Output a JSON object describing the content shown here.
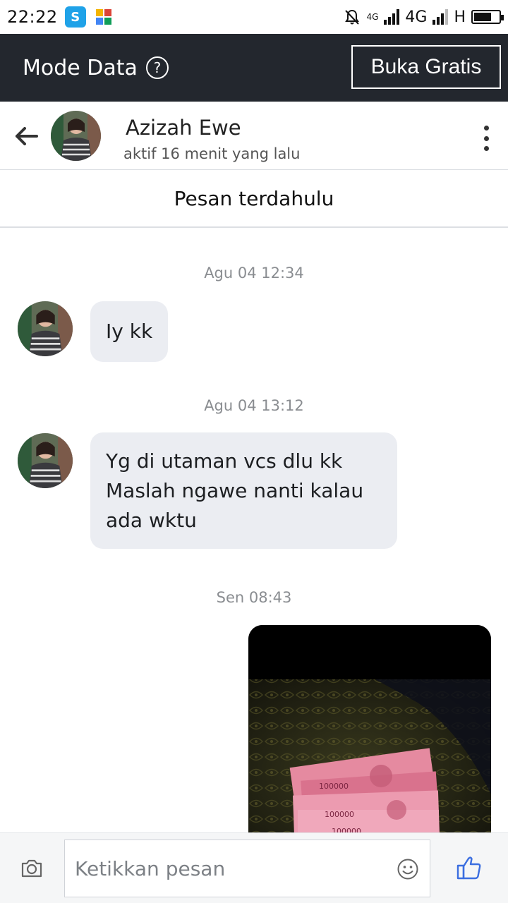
{
  "status_bar": {
    "time": "22:22",
    "network_label_1": "4G",
    "network_label_2": "4G",
    "network_label_3": "H",
    "battery_level": 0.7
  },
  "data_mode": {
    "title": "Mode Data",
    "help_symbol": "?",
    "free_button": "Buka Gratis"
  },
  "chat_header": {
    "contact_name": "Azizah Ewe",
    "contact_status": "aktif 16 menit yang lalu"
  },
  "older_messages_label": "Pesan terdahulu",
  "messages": [
    {
      "timestamp": "Agu 04 12:34",
      "text": "Iy kk"
    },
    {
      "timestamp": "Agu 04 13:12",
      "lines": [
        "Yg di utaman vcs dlu kk",
        "Maslah ngawe nanti kalau",
        "ada wktu"
      ]
    },
    {
      "timestamp": "Sen 08:43",
      "photo_banknote_label": "100000"
    }
  ],
  "composer": {
    "placeholder": "Ketikkan pesan"
  },
  "colors": {
    "data_bar": "#23272e",
    "bubble": "#ebedf2",
    "like": "#3b6ee0"
  },
  "icons": [
    "back-arrow-icon",
    "help-icon",
    "more-vertical-icon",
    "camera-icon",
    "emoji-icon",
    "thumbs-up-icon"
  ]
}
